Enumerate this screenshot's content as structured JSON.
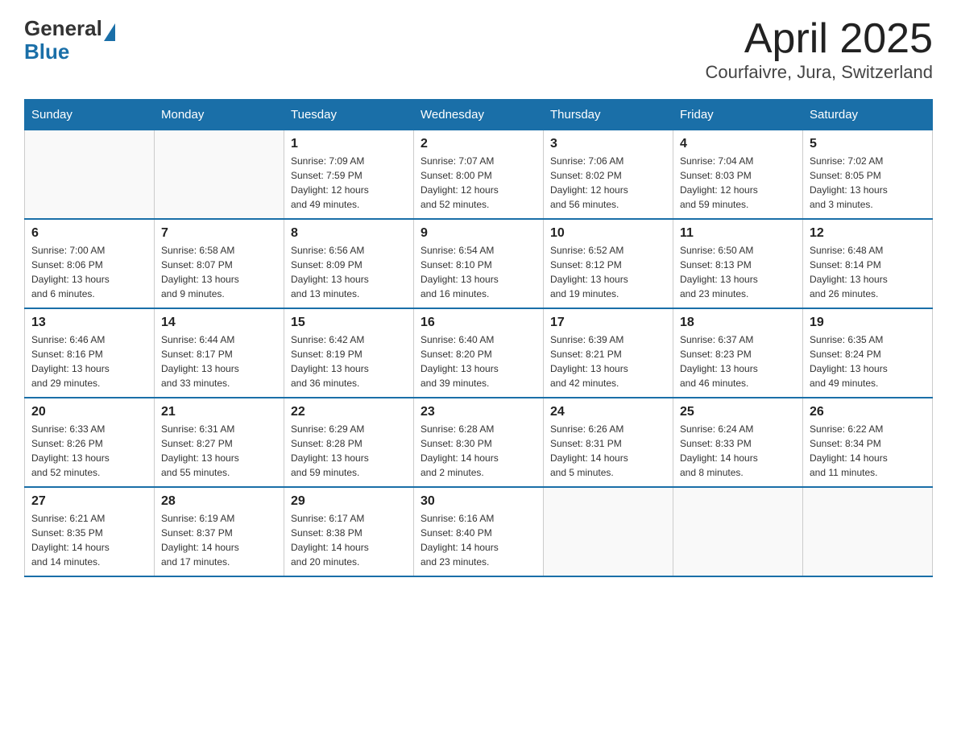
{
  "logo": {
    "general": "General",
    "triangle": "",
    "blue": "Blue"
  },
  "title": "April 2025",
  "subtitle": "Courfaivre, Jura, Switzerland",
  "days_of_week": [
    "Sunday",
    "Monday",
    "Tuesday",
    "Wednesday",
    "Thursday",
    "Friday",
    "Saturday"
  ],
  "weeks": [
    [
      {
        "day": "",
        "info": ""
      },
      {
        "day": "",
        "info": ""
      },
      {
        "day": "1",
        "info": "Sunrise: 7:09 AM\nSunset: 7:59 PM\nDaylight: 12 hours\nand 49 minutes."
      },
      {
        "day": "2",
        "info": "Sunrise: 7:07 AM\nSunset: 8:00 PM\nDaylight: 12 hours\nand 52 minutes."
      },
      {
        "day": "3",
        "info": "Sunrise: 7:06 AM\nSunset: 8:02 PM\nDaylight: 12 hours\nand 56 minutes."
      },
      {
        "day": "4",
        "info": "Sunrise: 7:04 AM\nSunset: 8:03 PM\nDaylight: 12 hours\nand 59 minutes."
      },
      {
        "day": "5",
        "info": "Sunrise: 7:02 AM\nSunset: 8:05 PM\nDaylight: 13 hours\nand 3 minutes."
      }
    ],
    [
      {
        "day": "6",
        "info": "Sunrise: 7:00 AM\nSunset: 8:06 PM\nDaylight: 13 hours\nand 6 minutes."
      },
      {
        "day": "7",
        "info": "Sunrise: 6:58 AM\nSunset: 8:07 PM\nDaylight: 13 hours\nand 9 minutes."
      },
      {
        "day": "8",
        "info": "Sunrise: 6:56 AM\nSunset: 8:09 PM\nDaylight: 13 hours\nand 13 minutes."
      },
      {
        "day": "9",
        "info": "Sunrise: 6:54 AM\nSunset: 8:10 PM\nDaylight: 13 hours\nand 16 minutes."
      },
      {
        "day": "10",
        "info": "Sunrise: 6:52 AM\nSunset: 8:12 PM\nDaylight: 13 hours\nand 19 minutes."
      },
      {
        "day": "11",
        "info": "Sunrise: 6:50 AM\nSunset: 8:13 PM\nDaylight: 13 hours\nand 23 minutes."
      },
      {
        "day": "12",
        "info": "Sunrise: 6:48 AM\nSunset: 8:14 PM\nDaylight: 13 hours\nand 26 minutes."
      }
    ],
    [
      {
        "day": "13",
        "info": "Sunrise: 6:46 AM\nSunset: 8:16 PM\nDaylight: 13 hours\nand 29 minutes."
      },
      {
        "day": "14",
        "info": "Sunrise: 6:44 AM\nSunset: 8:17 PM\nDaylight: 13 hours\nand 33 minutes."
      },
      {
        "day": "15",
        "info": "Sunrise: 6:42 AM\nSunset: 8:19 PM\nDaylight: 13 hours\nand 36 minutes."
      },
      {
        "day": "16",
        "info": "Sunrise: 6:40 AM\nSunset: 8:20 PM\nDaylight: 13 hours\nand 39 minutes."
      },
      {
        "day": "17",
        "info": "Sunrise: 6:39 AM\nSunset: 8:21 PM\nDaylight: 13 hours\nand 42 minutes."
      },
      {
        "day": "18",
        "info": "Sunrise: 6:37 AM\nSunset: 8:23 PM\nDaylight: 13 hours\nand 46 minutes."
      },
      {
        "day": "19",
        "info": "Sunrise: 6:35 AM\nSunset: 8:24 PM\nDaylight: 13 hours\nand 49 minutes."
      }
    ],
    [
      {
        "day": "20",
        "info": "Sunrise: 6:33 AM\nSunset: 8:26 PM\nDaylight: 13 hours\nand 52 minutes."
      },
      {
        "day": "21",
        "info": "Sunrise: 6:31 AM\nSunset: 8:27 PM\nDaylight: 13 hours\nand 55 minutes."
      },
      {
        "day": "22",
        "info": "Sunrise: 6:29 AM\nSunset: 8:28 PM\nDaylight: 13 hours\nand 59 minutes."
      },
      {
        "day": "23",
        "info": "Sunrise: 6:28 AM\nSunset: 8:30 PM\nDaylight: 14 hours\nand 2 minutes."
      },
      {
        "day": "24",
        "info": "Sunrise: 6:26 AM\nSunset: 8:31 PM\nDaylight: 14 hours\nand 5 minutes."
      },
      {
        "day": "25",
        "info": "Sunrise: 6:24 AM\nSunset: 8:33 PM\nDaylight: 14 hours\nand 8 minutes."
      },
      {
        "day": "26",
        "info": "Sunrise: 6:22 AM\nSunset: 8:34 PM\nDaylight: 14 hours\nand 11 minutes."
      }
    ],
    [
      {
        "day": "27",
        "info": "Sunrise: 6:21 AM\nSunset: 8:35 PM\nDaylight: 14 hours\nand 14 minutes."
      },
      {
        "day": "28",
        "info": "Sunrise: 6:19 AM\nSunset: 8:37 PM\nDaylight: 14 hours\nand 17 minutes."
      },
      {
        "day": "29",
        "info": "Sunrise: 6:17 AM\nSunset: 8:38 PM\nDaylight: 14 hours\nand 20 minutes."
      },
      {
        "day": "30",
        "info": "Sunrise: 6:16 AM\nSunset: 8:40 PM\nDaylight: 14 hours\nand 23 minutes."
      },
      {
        "day": "",
        "info": ""
      },
      {
        "day": "",
        "info": ""
      },
      {
        "day": "",
        "info": ""
      }
    ]
  ]
}
